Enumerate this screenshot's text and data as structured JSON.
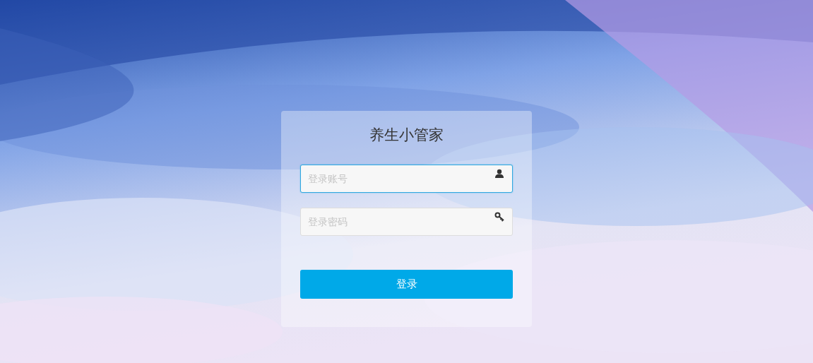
{
  "login_card": {
    "title": "养生小管家",
    "fields": [
      {
        "kind": "account",
        "placeholder": "登录账号",
        "focused": true
      },
      {
        "kind": "password",
        "placeholder": "登录密码",
        "focused": false
      }
    ],
    "submit": {
      "label": "登录"
    }
  }
}
